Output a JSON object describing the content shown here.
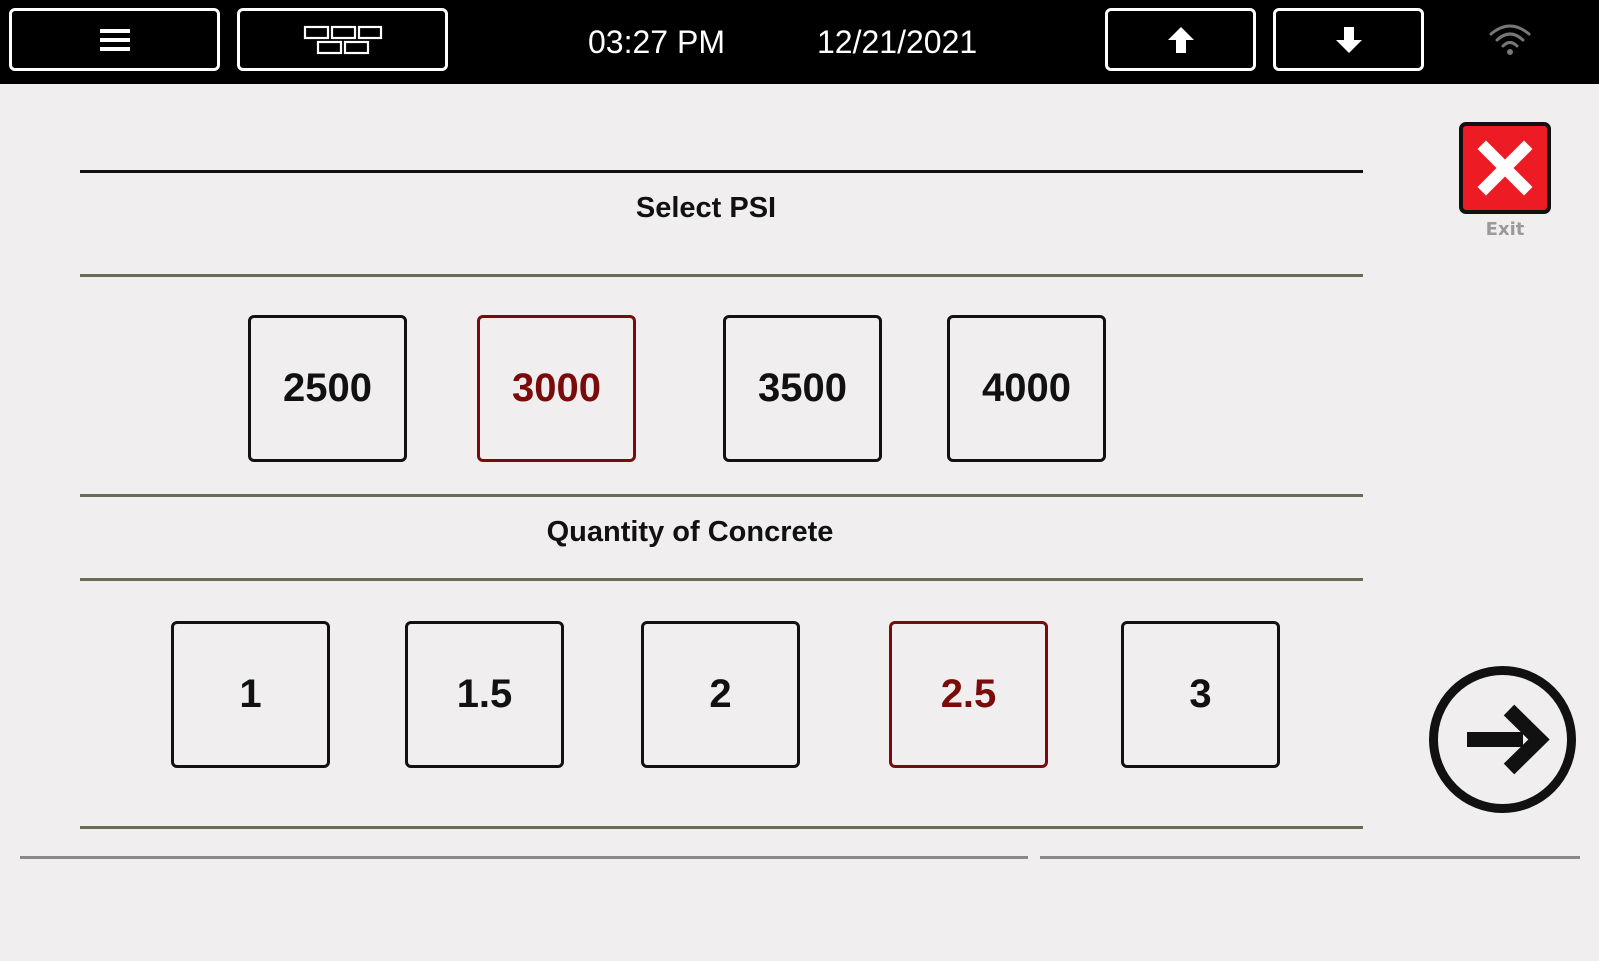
{
  "topbar": {
    "time": "03:27 PM",
    "date": "12/21/2021",
    "menu_icon": "hamburger-menu-icon",
    "layout_icon": "brick-grid-icon",
    "up_icon": "arrow-up-icon",
    "down_icon": "arrow-down-icon",
    "wifi_icon": "wifi-icon"
  },
  "exit": {
    "label": "Exit",
    "icon": "close-x-icon",
    "color": "#ed1c24"
  },
  "psi": {
    "title": "Select PSI",
    "options": [
      "2500",
      "3000",
      "3500",
      "4000"
    ],
    "selected": "3000"
  },
  "quantity": {
    "title": "Quantity of Concrete",
    "options": [
      "1",
      "1.5",
      "2",
      "2.5",
      "3"
    ],
    "selected": "2.5"
  },
  "next": {
    "icon": "arrow-right-circle-icon"
  },
  "colors": {
    "topbar": "#000000",
    "background": "#f0eeef",
    "selected": "#7a0b0b",
    "divider": "#6b6b55"
  }
}
